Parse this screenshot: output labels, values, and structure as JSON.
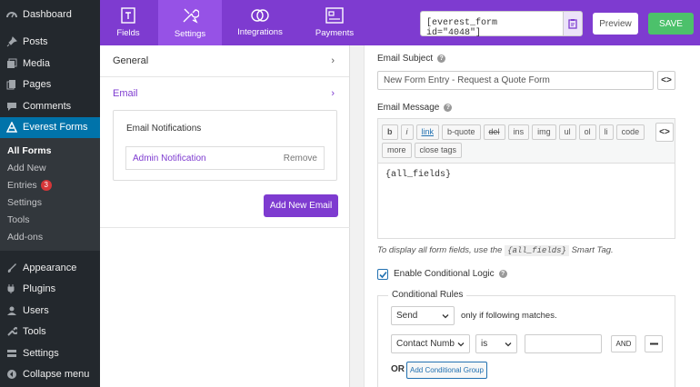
{
  "wp_menu": {
    "dashboard": "Dashboard",
    "posts": "Posts",
    "media": "Media",
    "pages": "Pages",
    "comments": "Comments",
    "everest_forms": "Everest Forms",
    "submenu": {
      "all_forms": "All Forms",
      "add_new": "Add New",
      "entries": "Entries",
      "entries_count": "3",
      "settings": "Settings",
      "tools": "Tools",
      "addons": "Add-ons"
    },
    "appearance": "Appearance",
    "plugins": "Plugins",
    "users": "Users",
    "tools": "Tools",
    "settings": "Settings",
    "collapse": "Collapse menu"
  },
  "builder_tabs": [
    {
      "label": "Fields",
      "icon": "fields-icon"
    },
    {
      "label": "Settings",
      "icon": "tools-icon"
    },
    {
      "label": "Integrations",
      "icon": "integrations-icon"
    },
    {
      "label": "Payments",
      "icon": "payments-icon"
    }
  ],
  "active_tab": "Settings",
  "header": {
    "shortcode": "[everest_form id=\"4048\"]",
    "preview_label": "Preview",
    "save_label": "SAVE"
  },
  "settings_nav": {
    "general": "General",
    "email": "Email"
  },
  "email_notifications": {
    "title": "Email Notifications",
    "items": [
      {
        "name": "Admin Notification",
        "remove": "Remove"
      }
    ],
    "add_button": "Add New Email"
  },
  "email_form": {
    "subject_label": "Email Subject",
    "subject_value": "New Form Entry - Request a Quote Form",
    "smart_tag_symbol": "<>",
    "message_label": "Email Message",
    "toolbar_buttons": [
      "b",
      "i",
      "link",
      "b-quote",
      "del",
      "ins",
      "img",
      "ul",
      "ol",
      "li",
      "code",
      "more",
      "close tags"
    ],
    "message_value": "{all_fields}",
    "hint_before": "To display all form fields, use the",
    "hint_tag": "{all_fields}",
    "hint_after": "Smart Tag."
  },
  "conditional": {
    "enable_label": "Enable Conditional Logic",
    "enabled": true,
    "rules_title": "Conditional Rules",
    "action_value": "Send",
    "action_suffix": "only if following matches.",
    "field_value": "Contact Numb",
    "operator_value": "is",
    "and_label": "AND",
    "or_label": "OR",
    "add_group_label": "Add Conditional Group"
  },
  "colors": {
    "brand_purple": "#7e3bd0",
    "save_green": "#4cc16b",
    "wp_blue": "#0073aa"
  }
}
